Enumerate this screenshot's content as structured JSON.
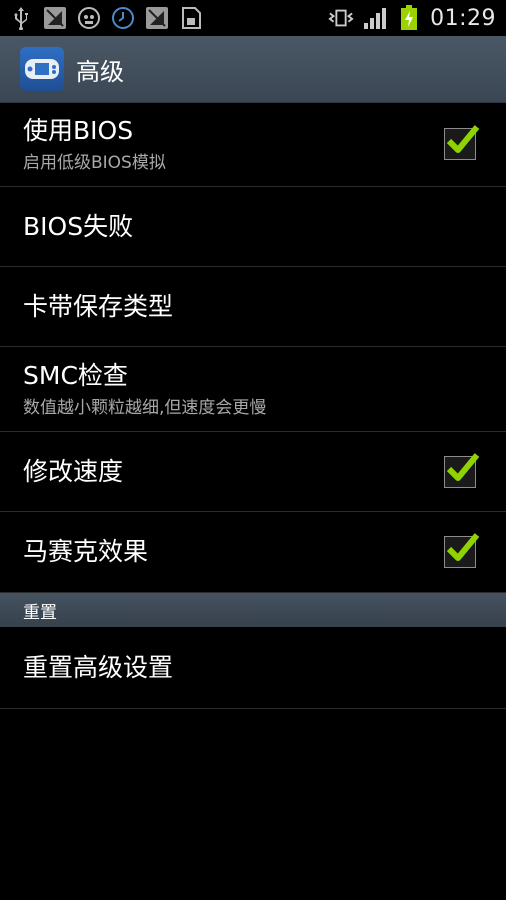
{
  "status_bar": {
    "icons": [
      "usb-icon",
      "no-signal-icon",
      "android-icon",
      "clock-sync-icon",
      "no-signal-icon",
      "sd-card-icon"
    ],
    "clock": "01:29"
  },
  "action_bar": {
    "title": "高级"
  },
  "items": [
    {
      "title": "使用BIOS",
      "subtitle": "启用低级BIOS模拟",
      "checked": true
    },
    {
      "title": "BIOS失败"
    },
    {
      "title": "卡带保存类型"
    },
    {
      "title": "SMC检查",
      "subtitle": "数值越小颗粒越细,但速度会更慢"
    },
    {
      "title": "修改速度",
      "checked": true
    },
    {
      "title": "马赛克效果",
      "checked": true
    }
  ],
  "section_reset": {
    "header": "重置",
    "item": {
      "title": "重置高级设置"
    }
  },
  "colors": {
    "check_green": "#8fd400",
    "actionbar": "#3f4c59",
    "divider": "#2c2c2c"
  }
}
